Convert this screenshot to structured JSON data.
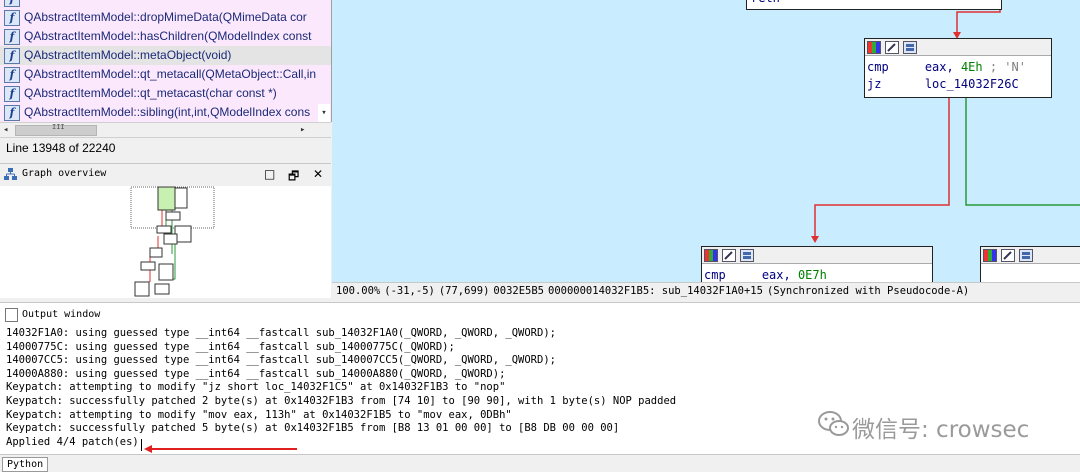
{
  "function_list": {
    "items": [
      {
        "label": "QAbstractItemModel::dropMimeData(QMimeData cor",
        "style": "pink"
      },
      {
        "label": "QAbstractItemModel::hasChildren(QModelIndex const",
        "style": "pink"
      },
      {
        "label": "QAbstractItemModel::metaObject(void)",
        "style": "selected"
      },
      {
        "label": "QAbstractItemModel::qt_metacall(QMetaObject::Call,in",
        "style": "pink"
      },
      {
        "label": "QAbstractItemModel::qt_metacast(char const *)",
        "style": "pink"
      },
      {
        "label": "QAbstractItemModel::sibling(int,int,QModelIndex cons",
        "style": "pink"
      }
    ],
    "icon": "function-icon",
    "line_status": "Line 13948 of 22240"
  },
  "graph_overview": {
    "title": "Graph overview",
    "icon": "graph-overview-icon",
    "buttons": {
      "minimize": "□",
      "float": "🗗",
      "close": "✕"
    }
  },
  "graph": {
    "block_top": {
      "line1_mnem": "cmp",
      "line1_ops": "eax, ",
      "line1_num": "4Eh",
      "line1_cmt": " ; 'N'",
      "line2_mnem": "jz",
      "line2_ops": "loc_14032F26C"
    },
    "block_bottom_left": {
      "line1_mnem": "cmp",
      "line1_ops": "eax, ",
      "line1_num": "0E7h"
    },
    "partial_top_text": "retn",
    "colors": {
      "background": "#c9ecff",
      "edge_red": "#e03030",
      "edge_green": "#2a9a3a"
    }
  },
  "status_bar": {
    "zoom": "100.00%",
    "cursor": "(-31,-5)",
    "view": "(77,699)",
    "offset": "0032E5B5",
    "address": "000000014032F1B5: sub_14032F1A0+15",
    "sync": "(Synchronized with Pseudocode-A)"
  },
  "output_window": {
    "title": "Output window",
    "icon": "output-window-icon",
    "lines": [
      "14032F1A0: using guessed type __int64 __fastcall sub_14032F1A0(_QWORD, _QWORD, _QWORD);",
      "14000775C: using guessed type __int64 __fastcall sub_14000775C(_QWORD);",
      "140007CC5: using guessed type __int64 __fastcall sub_140007CC5(_QWORD, _QWORD, _QWORD);",
      "14000A880: using guessed type __int64 __fastcall sub_14000A880(_QWORD, _QWORD);",
      "Keypatch: attempting to modify \"jz short loc_14032F1C5\" at 0x14032F1B3 to \"nop\"",
      "Keypatch: successfully patched 2 byte(s) at 0x14032F1B3 from [74 10] to [90 90], with 1 byte(s) NOP padded",
      "Keypatch: attempting to modify \"mov eax, 113h\" at 0x14032F1B5 to \"mov eax, 0DBh\"",
      "Keypatch: successfully patched 5 byte(s) at 0x14032F1B5 from [B8 13 01 00 00] to [B8 DB 00 00 00]",
      "Applied 4/4 patch(es)"
    ]
  },
  "watermark": {
    "text": "微信号: crowsec",
    "icon": "wechat-icon"
  },
  "python_button": {
    "label": "Python"
  }
}
